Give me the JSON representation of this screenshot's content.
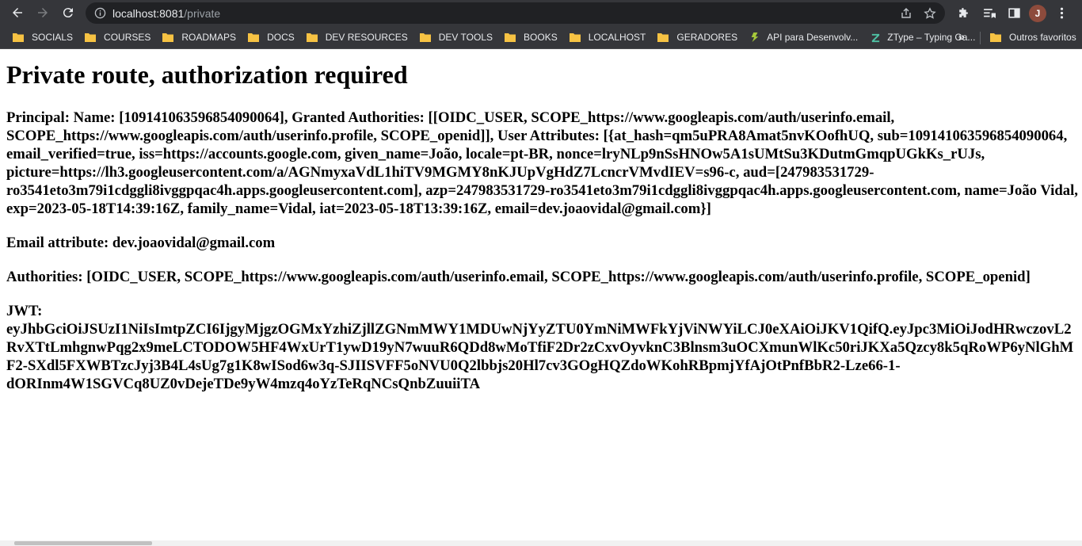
{
  "browser": {
    "url_host": "localhost:8081",
    "url_path": "/private",
    "avatar_letter": "J",
    "accent_color": "#35363a",
    "icons": [
      "back-icon",
      "forward-icon",
      "reload-icon",
      "info-icon",
      "share-icon",
      "star-icon",
      "extensions-icon",
      "reading-list-icon",
      "side-panel-icon"
    ]
  },
  "bookmarks": {
    "items": [
      {
        "label": "SOCIALS",
        "icon": "folder-icon"
      },
      {
        "label": "COURSES",
        "icon": "folder-icon"
      },
      {
        "label": "ROADMAPS",
        "icon": "folder-icon"
      },
      {
        "label": "DOCS",
        "icon": "folder-icon"
      },
      {
        "label": "DEV RESOURCES",
        "icon": "folder-icon"
      },
      {
        "label": "DEV TOOLS",
        "icon": "folder-icon"
      },
      {
        "label": "BOOKS",
        "icon": "folder-icon"
      },
      {
        "label": "LOCALHOST",
        "icon": "folder-icon"
      },
      {
        "label": "GERADORES",
        "icon": "folder-icon"
      },
      {
        "label": "API para Desenvolv...",
        "icon": "api-favicon"
      },
      {
        "label": "ZType – Typing Ga...",
        "icon": "ztype-favicon"
      }
    ],
    "more": "»",
    "other": "Outros favoritos"
  },
  "page": {
    "title": "Private route, authorization required",
    "principal": "Principal: Name: [109141063596854090064], Granted Authorities: [[OIDC_USER, SCOPE_https://www.googleapis.com/auth/userinfo.email, SCOPE_https://www.googleapis.com/auth/userinfo.profile, SCOPE_openid]], User Attributes: [{at_hash=qm5uPRA8Amat5nvKOofhUQ, sub=109141063596854090064, email_verified=true, iss=https://accounts.google.com, given_name=João, locale=pt-BR, nonce=lryNLp9nSsHNOw5A1sUMtSu3KDutmGmqpUGkKs_rUJs, picture=https://lh3.googleusercontent.com/a/AGNmyxaVdL1hiTV9MGMY8nKJUpVgHdZ7LcncrVMvdIEV=s96-c, aud=[247983531729-ro3541eto3m79i1cdggli8ivggpqac4h.apps.googleusercontent.com], azp=247983531729-ro3541eto3m79i1cdggli8ivggpqac4h.apps.googleusercontent.com, name=João Vidal, exp=2023-05-18T14:39:16Z, family_name=Vidal, iat=2023-05-18T13:39:16Z, email=dev.joaovidal@gmail.com}]",
    "email": "Email attribute: dev.joaovidal@gmail.com",
    "authorities": "Authorities: [OIDC_USER, SCOPE_https://www.googleapis.com/auth/userinfo.email, SCOPE_https://www.googleapis.com/auth/userinfo.profile, SCOPE_openid]",
    "jwt_label": "JWT:",
    "jwt_lines": [
      "eyJhbGciOiJSUzI1NiIsImtpZCI6IjgyMjgzOGMxYzhiZjllZGNmMWY1MDUwNjYyZTU0YmNiMWFkYjViNWYiLCJ0eXAiOiJKV1QifQ.eyJpc3MiOiJodHRwczovL2",
      "RvXTtLmhgnwPqg2x9meLCTODOW5HF4WxUrT1ywD19yN7wuuR6QDd8wMoTfiF2Dr2zCxvOyvknC3Blnsm3uOCXmunWlKc50riJKXa5Qzcy8k5qRoWP6yNlGhM",
      "F2-SXdl5FXWBTzcJyj3B4L4sUg7g1K8wISod6w3q-SJIISVFF5oNVU0Q2lbbjs20Hl7cv3GOgHQZdoWKohRBpmjYfAjOtPnfBbR2-Lze66-1-",
      "dORInm4W1SGVCq8UZ0vDejeTDe9yW4mzq4oYzTeRqNCsQnbZuuiiTA"
    ]
  }
}
